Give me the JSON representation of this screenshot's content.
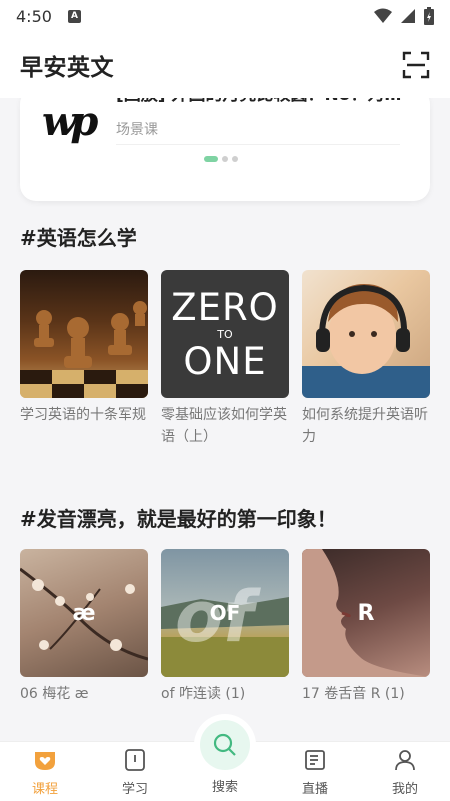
{
  "status_bar": {
    "time": "4:50",
    "notification": "A"
  },
  "header": {
    "title": "早安英文"
  },
  "banner": {
    "logo_text": "wp",
    "title": "[回放] 外国的月亮比较圆？No！为…",
    "subtitle": "场景课"
  },
  "sections": [
    {
      "title": "#英语怎么学",
      "items": [
        {
          "label": "学习英语的十条军规"
        },
        {
          "label": "零基础应该如何学英语（上）",
          "thumb_big": "ZERO",
          "thumb_mid": "TO",
          "thumb_big2": "ONE"
        },
        {
          "label": "如何系统提升英语听力"
        }
      ]
    },
    {
      "title": "#发音漂亮，就是最好的第一印象！",
      "items": [
        {
          "label": "06 梅花 æ",
          "thumb_text": "æ"
        },
        {
          "label": "of 咋连读 (1)",
          "thumb_text": "OF"
        },
        {
          "label": "17 卷舌音 R (1)",
          "thumb_text": "R"
        }
      ]
    }
  ],
  "tabs": [
    {
      "label": "课程",
      "icon": "heart-box-icon",
      "active": true
    },
    {
      "label": "学习",
      "icon": "notebook-icon"
    },
    {
      "label": "搜索",
      "icon": "search-icon"
    },
    {
      "label": "直播",
      "icon": "live-icon"
    },
    {
      "label": "我的",
      "icon": "person-icon"
    }
  ],
  "colors": {
    "accent": "#f2a13d",
    "dot_active": "#7fd3a3",
    "search_bubble": "#e7f7ef"
  }
}
